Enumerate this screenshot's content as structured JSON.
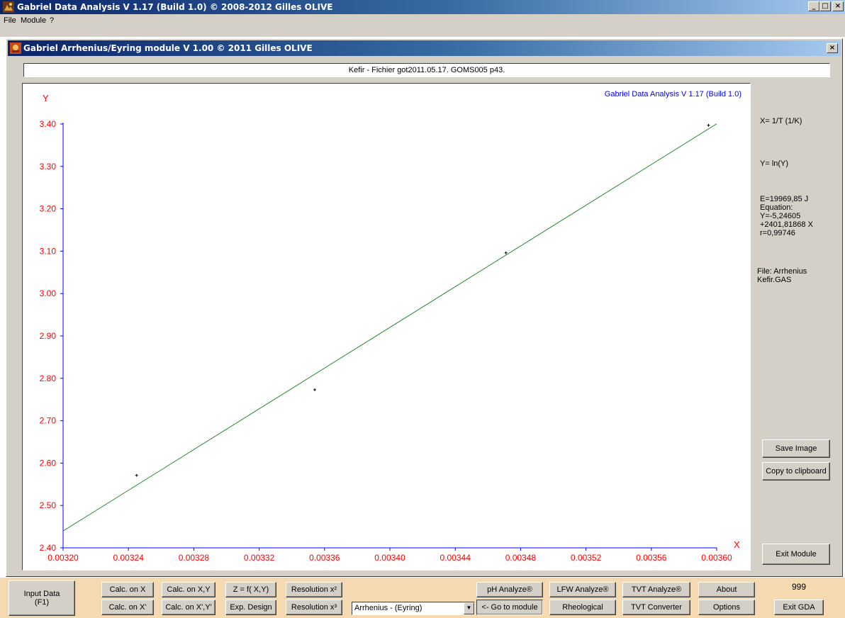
{
  "window": {
    "title": "Gabriel Data Analysis V 1.17 (Build 1.0) © 2008-2012 Gilles OLIVE",
    "buttons": [
      "_",
      "□",
      "×"
    ]
  },
  "menu": [
    "File",
    "Module",
    "?"
  ],
  "module": {
    "title": "Gabriel Arrhenius/Eyring module V 1.00 © 2011 Gilles OLIVE",
    "close": "×",
    "file_caption": "Kefir - Fichier got2011.05.17. GOMS005 p43."
  },
  "side_panel": {
    "x_label": "X= 1/T (1/K)",
    "y_label": "Y= ln(Y)",
    "equation": "E=19969,85 J\nEquation:\nY=-5,24605\n+2401,81868 X\nr=0,99746",
    "file": "File: Arrhenius\nKefir.GAS",
    "save_image": "Save Image",
    "copy_clipboard": "Copy to clipboard",
    "exit_module": "Exit Module"
  },
  "chart_data": {
    "type": "scatter",
    "watermark": "Gabriel Data Analysis V 1.17 (Build 1.0)",
    "xlabel": "X",
    "ylabel": "Y",
    "xlim": [
      0.0032,
      0.0036
    ],
    "ylim": [
      2.4,
      3.4
    ],
    "x_ticks": [
      "0.00320",
      "0.00324",
      "0.00328",
      "0.00332",
      "0.00336",
      "0.00340",
      "0.00344",
      "0.00348",
      "0.00352",
      "0.00356",
      "0.00360"
    ],
    "y_ticks": [
      "2.40",
      "2.50",
      "2.60",
      "2.70",
      "2.80",
      "2.90",
      "3.00",
      "3.10",
      "3.20",
      "3.30",
      "3.40"
    ],
    "points": [
      {
        "x": 0.003245,
        "y": 2.571
      },
      {
        "x": 0.003354,
        "y": 2.773
      },
      {
        "x": 0.003471,
        "y": 3.096
      },
      {
        "x": 0.003595,
        "y": 3.397
      }
    ],
    "fit": {
      "intercept": -5.24605,
      "slope": 2401.81868,
      "color": "#2e8b2e"
    },
    "axis_color": "#0000ff",
    "tick_label_color": "#ff0000",
    "point_color": "#000000"
  },
  "bottom": {
    "input_data": "Input Data\n(F1)",
    "calc_x": "Calc. on X",
    "calc_x2": "Calc. on X'",
    "calc_xy": "Calc. on X,Y",
    "calc_xy2": "Calc. on X',Y'",
    "zfxy": "Z = f( X,Y)",
    "exp_design": "Exp. Design",
    "resolution1": "Resolution x²",
    "resolution2": "Resolution x³",
    "module_select": "Arrhenius - (Eyring)",
    "ph_analyze": "pH Analyze®",
    "goto_module": "<- Go to module",
    "lfw_analyze": "LFW Analyze®",
    "rheological": "Rheological",
    "tvt_analyze": "TVT Analyze®",
    "tvt_converter": "TVT Converter",
    "about": "About",
    "options": "Options",
    "counter": "999",
    "exit_gda": "Exit GDA"
  }
}
